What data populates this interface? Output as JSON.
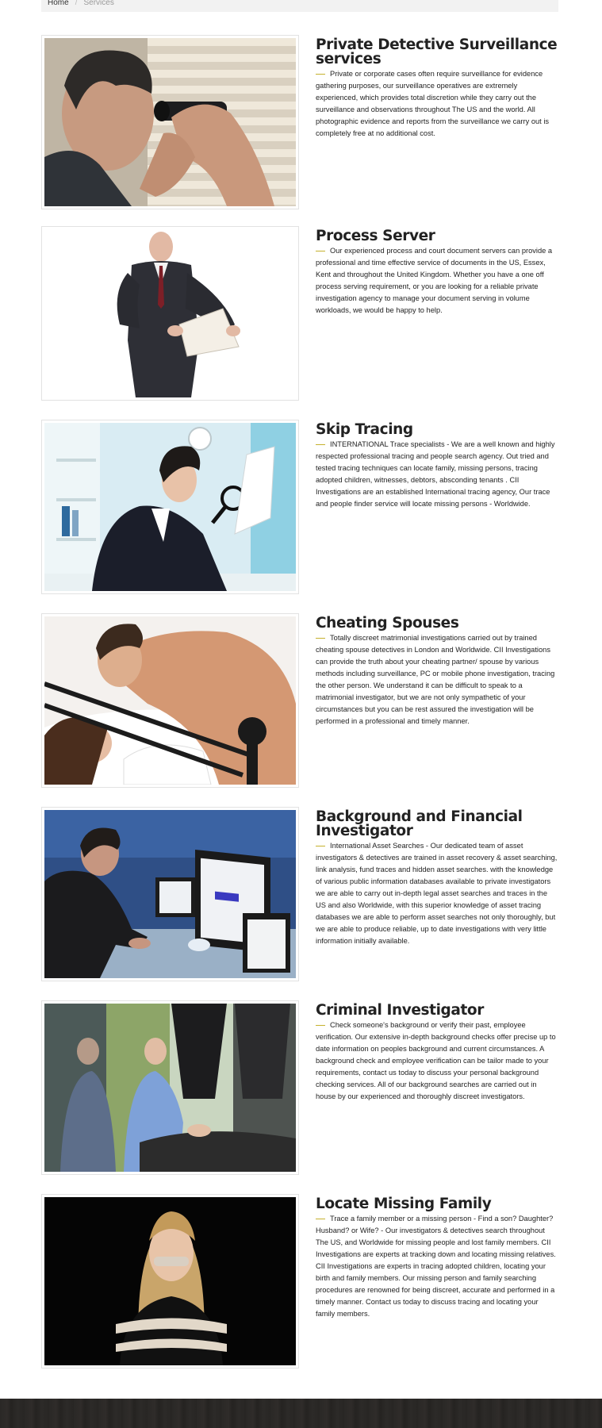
{
  "breadcrumb": {
    "home": "Home",
    "separator": "/",
    "current": "Services"
  },
  "colors": {
    "accent": "#c5b12e",
    "footer": "#2a2826"
  },
  "services": [
    {
      "title": "Private Detective Surveillance services",
      "image": "man-with-binoculars",
      "text": "Private or corporate cases often require surveillance for evidence gathering purposes, our surveillance operatives are extremely experienced, which provides total discretion while they carry out the surveillance and observations throughout The US and the world. All photographic evidence and reports from the surveillance we carry out is completely free at no additional cost."
    },
    {
      "title": "Process Server",
      "image": "man-in-suit-with-documents",
      "text": "Our experienced process and court document servers can provide a professional and time effective service of documents in the US, Essex, Kent and throughout the United Kingdom. Whether you have a one off process serving requirement, or you are looking for a reliable private investigation agency to manage your document serving in volume workloads, we would be happy to help."
    },
    {
      "title": "Skip Tracing",
      "image": "woman-with-magnifying-glass",
      "text": "INTERNATIONAL Trace specialists - We are a well known and highly respected professional tracing and people search agency. Out tried and tested tracing techniques can locate family, missing persons, tracing adopted children, witnesses, debtors, absconding tenants . CII Investigations are an established International tracing agency, Our trace and people finder service will locate missing persons - Worldwide."
    },
    {
      "title": "Cheating Spouses",
      "image": "couple-in-bed",
      "text": "Totally discreet matrimonial investigations carried out by trained cheating spouse detectives in London and Worldwide. CII Investigations can provide the truth about your cheating partner/ spouse by various methods including surveillance, PC or mobile phone investigation, tracing the other person. We understand it can be difficult to speak to a matrimonial investigator, but we are not only sympathetic of your circumstances but you can be rest assured the investigation will be performed in a professional and timely manner."
    },
    {
      "title": "Background and Financial Investigator",
      "image": "man-at-computers",
      "text": "International Asset Searches - Our dedicated team of asset investigators & detectives are trained in asset recovery & asset searching, link analysis, fund traces and hidden asset searches. with the knowledge of various public information databases available to private investigators we are able to carry out in-depth legal asset searches and traces in the US and also Worldwide, with this superior knowledge of asset tracing databases we are able to perform asset searches not only thoroughly, but we are able to produce reliable, up to date investigations with very little information initially available."
    },
    {
      "title": "Criminal Investigator",
      "image": "crime-scene-collage",
      "text": "Check someone's background or verify their past, employee verification. Our extensive in-depth background checks offer precise up to date information on peoples background and current circumstances. A background check and employee verification can be tailor made to your requirements, contact us today to discuss your personal background checking services. All of our background searches are carried out in house by our experienced and thoroughly discreet investigators."
    },
    {
      "title": "Locate Missing Family",
      "image": "bound-woman-dark",
      "text": "Trace a family member or a missing person - Find a son? Daughter? Husband? or Wife? - Our investigators & detectives search throughout The US, and Worldwide for missing people and lost family members. CII Investigations are experts at tracking down and locating missing relatives. CII Investigations are experts in tracing adopted children, locating your birth and family members. Our missing person and family searching procedures are renowned for being discreet, accurate and performed in a timely manner. Contact us today to discuss tracing and locating your family members."
    }
  ]
}
